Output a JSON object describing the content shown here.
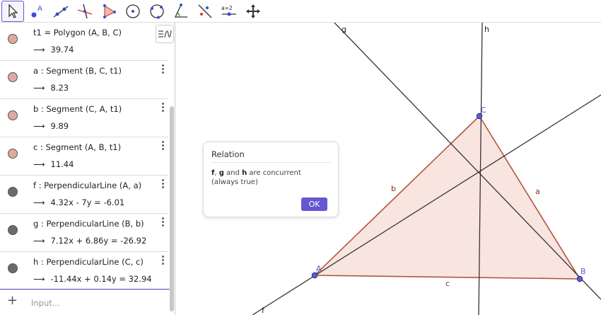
{
  "toolbar": {
    "tools": [
      {
        "name": "move-tool",
        "active": true
      },
      {
        "name": "point-tool",
        "label": "A"
      },
      {
        "name": "line-tool"
      },
      {
        "name": "perpendicular-line-tool"
      },
      {
        "name": "polygon-tool"
      },
      {
        "name": "circle-center-point-tool"
      },
      {
        "name": "circle-three-points-tool"
      },
      {
        "name": "angle-tool"
      },
      {
        "name": "reflect-tool"
      },
      {
        "name": "slider-tool",
        "label": "a=2"
      },
      {
        "name": "move-graphics-view-tool"
      }
    ]
  },
  "algebra": {
    "rows": [
      {
        "definition": "t1 = Polygon (A, B, C)",
        "value": "39.74",
        "color": "#e0a9a0"
      },
      {
        "definition": "a : Segment (B, C, t1)",
        "value": "8.23",
        "color": "#e0a9a0"
      },
      {
        "definition": "b : Segment (C, A, t1)",
        "value": "9.89",
        "color": "#e0a9a0"
      },
      {
        "definition": "c : Segment (A, B, t1)",
        "value": "11.44",
        "color": "#e0a9a0"
      },
      {
        "definition": "f : PerpendicularLine (A, a)",
        "value": "4.32x - 7y = -6.01",
        "color": "#6b6b6b"
      },
      {
        "definition": "g : PerpendicularLine (B, b)",
        "value": "7.12x + 6.86y = -26.92",
        "color": "#6b6b6b"
      },
      {
        "definition": "h : PerpendicularLine (C, c)",
        "value": "-11.44x + 0.14y = 32.94",
        "color": "#6b6b6b"
      }
    ],
    "arrow": "⟶",
    "input_placeholder": "Input...",
    "plus": "+"
  },
  "graphics": {
    "points": {
      "A": "A",
      "B": "B",
      "C": "C"
    },
    "segments": {
      "a": "a",
      "b": "b",
      "c": "c"
    },
    "lines": {
      "f": "f",
      "g": "g",
      "h": "h"
    },
    "colors": {
      "polygon_fill": "#f5dcd6",
      "polygon_stroke": "#b5533c",
      "point": "#5b5bdb",
      "line": "#333333",
      "segment_label": "#8b2f1b",
      "point_label": "#5b5bdb"
    }
  },
  "dialog": {
    "title": "Relation",
    "f": "f",
    "comma": ", ",
    "g": "g",
    "and": " and ",
    "h": "h",
    "concurrent": " are concurrent",
    "always_true": "(always true)",
    "ok_label": "OK"
  }
}
